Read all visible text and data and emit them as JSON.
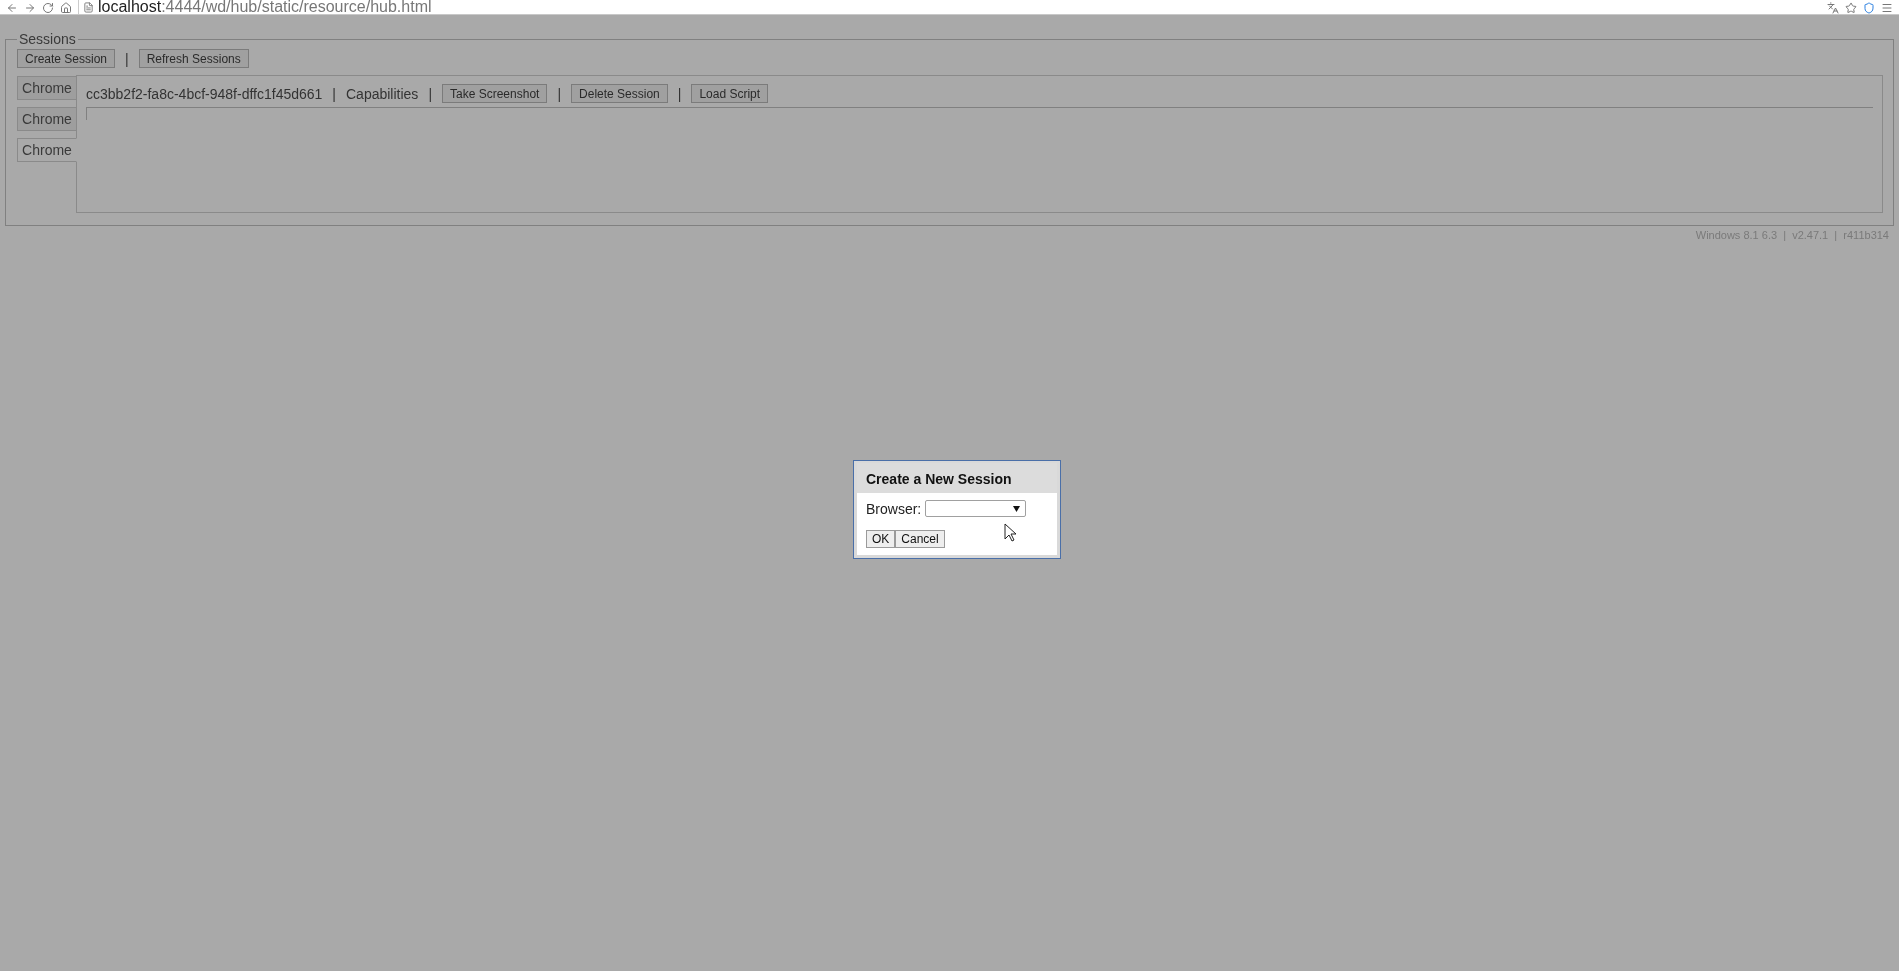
{
  "browser": {
    "url_host": "localhost",
    "url_rest": ":4444/wd/hub/static/resource/hub.html"
  },
  "sessions": {
    "legend": "Sessions",
    "actions": [
      {
        "kind": "button",
        "label": "Create Session"
      },
      {
        "kind": "separator",
        "label": "|"
      },
      {
        "kind": "button",
        "label": "Refresh Sessions"
      }
    ],
    "tabs": [
      {
        "label": "Chrome",
        "selected": false
      },
      {
        "label": "Chrome",
        "selected": false
      },
      {
        "label": "Chrome",
        "selected": true
      }
    ],
    "toolbar": [
      {
        "kind": "text",
        "label": "cc3bb2f2-fa8c-4bcf-948f-dffc1f45d661"
      },
      {
        "kind": "separator",
        "label": "|"
      },
      {
        "kind": "text",
        "label": "Capabilities"
      },
      {
        "kind": "separator",
        "label": "|"
      },
      {
        "kind": "button",
        "label": "Take Screenshot"
      },
      {
        "kind": "separator",
        "label": "|"
      },
      {
        "kind": "button",
        "label": "Delete Session"
      },
      {
        "kind": "separator",
        "label": "|"
      },
      {
        "kind": "button",
        "label": "Load Script"
      }
    ]
  },
  "footer": "Windows 8.1 6.3  |  v2.47.1  |  r411b314",
  "dialog": {
    "title": "Create a New Session",
    "field_label": "Browser:",
    "buttons": [
      "OK",
      "Cancel"
    ]
  }
}
